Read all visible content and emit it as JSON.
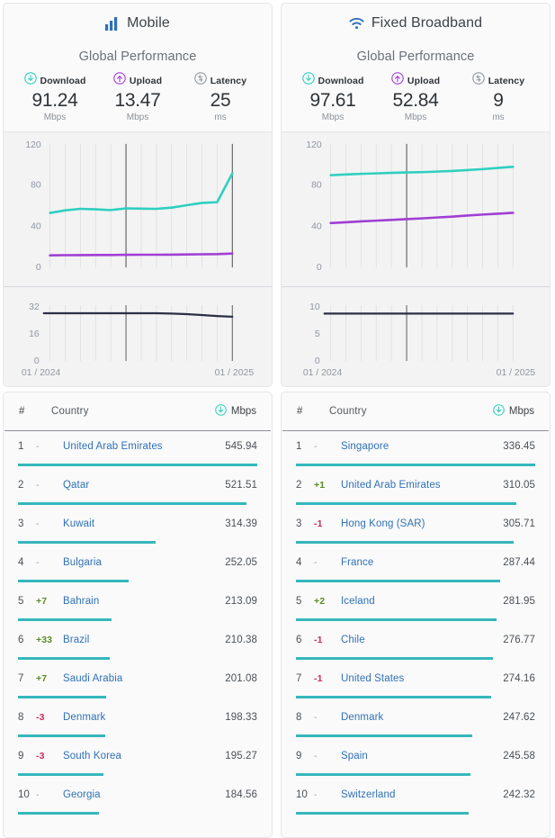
{
  "panels": [
    {
      "id": "mobile",
      "title": "Mobile",
      "icon": "bars-icon",
      "global_performance_label": "Global Performance",
      "metrics": [
        {
          "icon": "download-icon",
          "label": "Download",
          "value": "91.24",
          "unit": "Mbps"
        },
        {
          "icon": "upload-icon",
          "label": "Upload",
          "value": "13.47",
          "unit": "Mbps"
        },
        {
          "icon": "latency-icon",
          "label": "Latency",
          "value": "25",
          "unit": "ms"
        }
      ],
      "speed_chart": {
        "yticks": [
          "120",
          "80",
          "40",
          "0"
        ]
      },
      "latency_chart": {
        "yticks": [
          "32",
          "16",
          "0"
        ],
        "xticks": [
          "01 / 2024",
          "01 / 2025"
        ]
      },
      "table": {
        "headers": {
          "rank": "#",
          "country": "Country",
          "unit": "Mbps",
          "unit_icon": "download-icon"
        },
        "rows": [
          {
            "rank": "1",
            "delta": "-",
            "delta_dir": "flat",
            "country": "United Arab Emirates",
            "value": "545.94",
            "bar_pct": 100.0
          },
          {
            "rank": "2",
            "delta": "-",
            "delta_dir": "flat",
            "country": "Qatar",
            "value": "521.51",
            "bar_pct": 95.5
          },
          {
            "rank": "3",
            "delta": "-",
            "delta_dir": "flat",
            "country": "Kuwait",
            "value": "314.39",
            "bar_pct": 57.6
          },
          {
            "rank": "4",
            "delta": "-",
            "delta_dir": "flat",
            "country": "Bulgaria",
            "value": "252.05",
            "bar_pct": 46.2
          },
          {
            "rank": "5",
            "delta": "+7",
            "delta_dir": "up",
            "country": "Bahrain",
            "value": "213.09",
            "bar_pct": 39.0
          },
          {
            "rank": "6",
            "delta": "+33",
            "delta_dir": "up",
            "country": "Brazil",
            "value": "210.38",
            "bar_pct": 38.5
          },
          {
            "rank": "7",
            "delta": "+7",
            "delta_dir": "up",
            "country": "Saudi Arabia",
            "value": "201.08",
            "bar_pct": 36.8
          },
          {
            "rank": "8",
            "delta": "-3",
            "delta_dir": "down",
            "country": "Denmark",
            "value": "198.33",
            "bar_pct": 36.3
          },
          {
            "rank": "9",
            "delta": "-3",
            "delta_dir": "down",
            "country": "South Korea",
            "value": "195.27",
            "bar_pct": 35.8
          },
          {
            "rank": "10",
            "delta": "-",
            "delta_dir": "flat",
            "country": "Georgia",
            "value": "184.56",
            "bar_pct": 33.8
          }
        ]
      }
    },
    {
      "id": "fixed-broadband",
      "title": "Fixed Broadband",
      "icon": "wifi-icon",
      "global_performance_label": "Global Performance",
      "metrics": [
        {
          "icon": "download-icon",
          "label": "Download",
          "value": "97.61",
          "unit": "Mbps"
        },
        {
          "icon": "upload-icon",
          "label": "Upload",
          "value": "52.84",
          "unit": "Mbps"
        },
        {
          "icon": "latency-icon",
          "label": "Latency",
          "value": "9",
          "unit": "ms"
        }
      ],
      "speed_chart": {
        "yticks": [
          "120",
          "80",
          "40",
          "0"
        ]
      },
      "latency_chart": {
        "yticks": [
          "10",
          "5",
          "0"
        ],
        "xticks": [
          "01 / 2024",
          "01 / 2025"
        ]
      },
      "table": {
        "headers": {
          "rank": "#",
          "country": "Country",
          "unit": "Mbps",
          "unit_icon": "download-icon"
        },
        "rows": [
          {
            "rank": "1",
            "delta": "-",
            "delta_dir": "flat",
            "country": "Singapore",
            "value": "336.45",
            "bar_pct": 100.0
          },
          {
            "rank": "2",
            "delta": "+1",
            "delta_dir": "up",
            "country": "United Arab Emirates",
            "value": "310.05",
            "bar_pct": 92.2
          },
          {
            "rank": "3",
            "delta": "-1",
            "delta_dir": "down",
            "country": "Hong Kong (SAR)",
            "value": "305.71",
            "bar_pct": 90.9
          },
          {
            "rank": "4",
            "delta": "-",
            "delta_dir": "flat",
            "country": "France",
            "value": "287.44",
            "bar_pct": 85.4
          },
          {
            "rank": "5",
            "delta": "+2",
            "delta_dir": "up",
            "country": "Iceland",
            "value": "281.95",
            "bar_pct": 83.8
          },
          {
            "rank": "6",
            "delta": "-1",
            "delta_dir": "down",
            "country": "Chile",
            "value": "276.77",
            "bar_pct": 82.3
          },
          {
            "rank": "7",
            "delta": "-1",
            "delta_dir": "down",
            "country": "United States",
            "value": "274.16",
            "bar_pct": 81.5
          },
          {
            "rank": "8",
            "delta": "-",
            "delta_dir": "flat",
            "country": "Denmark",
            "value": "247.62",
            "bar_pct": 73.6
          },
          {
            "rank": "9",
            "delta": "-",
            "delta_dir": "flat",
            "country": "Spain",
            "value": "245.58",
            "bar_pct": 73.0
          },
          {
            "rank": "10",
            "delta": "-",
            "delta_dir": "flat",
            "country": "Switzerland",
            "value": "242.32",
            "bar_pct": 72.0
          }
        ]
      }
    }
  ],
  "colors": {
    "download_line": "#2ecfc0",
    "upload_line": "#a03ed4",
    "latency_line": "#2b2f45",
    "bar": "#35b7bc",
    "link": "#2f71b8",
    "up": "#5c8a24",
    "down": "#cf2b5b",
    "mode_icon": "#2f6fb5"
  },
  "chart_data": [
    {
      "type": "line",
      "title": "Mobile Global Performance",
      "panel": "mobile",
      "xlabel": "",
      "ylabel": "Mbps",
      "ylim": [
        0,
        120
      ],
      "yticks": [
        0,
        40,
        80,
        120
      ],
      "x": [
        "01/2024",
        "02/2024",
        "03/2024",
        "04/2024",
        "05/2024",
        "06/2024",
        "07/2024",
        "08/2024",
        "09/2024",
        "10/2024",
        "11/2024",
        "12/2024",
        "01/2025"
      ],
      "grid": true,
      "legend": "none",
      "series": [
        {
          "name": "Download",
          "color": "#2ecfc0",
          "values": [
            53.0,
            55.5,
            57.0,
            56.5,
            55.8,
            57.4,
            57.2,
            57.0,
            58.2,
            60.5,
            62.8,
            63.5,
            91.24
          ]
        },
        {
          "name": "Upload",
          "color": "#a03ed4",
          "values": [
            11.6,
            11.8,
            11.9,
            12.0,
            12.0,
            12.1,
            12.2,
            12.2,
            12.3,
            12.5,
            12.7,
            12.9,
            13.47
          ]
        }
      ]
    },
    {
      "type": "line",
      "title": "Mobile Latency",
      "panel": "mobile",
      "xlabel": "",
      "ylabel": "ms",
      "ylim": [
        0,
        32
      ],
      "yticks": [
        0,
        16,
        32
      ],
      "xticklabels": [
        "01 / 2024",
        "01 / 2025"
      ],
      "x": [
        "01/2024",
        "02/2024",
        "03/2024",
        "04/2024",
        "05/2024",
        "06/2024",
        "07/2024",
        "08/2024",
        "09/2024",
        "10/2024",
        "11/2024",
        "12/2024",
        "01/2025"
      ],
      "grid": true,
      "legend": "none",
      "series": [
        {
          "name": "Latency",
          "color": "#2b2f45",
          "values": [
            27.0,
            27.0,
            27.0,
            27.0,
            27.0,
            27.0,
            27.0,
            27.0,
            26.8,
            26.5,
            26.0,
            25.4,
            25.0
          ]
        }
      ]
    },
    {
      "type": "line",
      "title": "Fixed Broadband Global Performance",
      "panel": "fixed-broadband",
      "xlabel": "",
      "ylabel": "Mbps",
      "ylim": [
        0,
        120
      ],
      "yticks": [
        0,
        40,
        80,
        120
      ],
      "x": [
        "01/2024",
        "02/2024",
        "03/2024",
        "04/2024",
        "05/2024",
        "06/2024",
        "07/2024",
        "08/2024",
        "09/2024",
        "10/2024",
        "11/2024",
        "12/2024",
        "01/2025"
      ],
      "grid": true,
      "legend": "none",
      "series": [
        {
          "name": "Download",
          "color": "#2ecfc0",
          "values": [
            89.5,
            90.2,
            90.8,
            91.3,
            91.8,
            92.2,
            92.5,
            93.0,
            93.6,
            94.5,
            95.4,
            96.5,
            97.61
          ]
        },
        {
          "name": "Upload",
          "color": "#a03ed4",
          "values": [
            43.0,
            43.8,
            44.6,
            45.3,
            46.0,
            46.8,
            47.5,
            48.3,
            49.2,
            50.2,
            51.2,
            52.0,
            52.84
          ]
        }
      ]
    },
    {
      "type": "line",
      "title": "Fixed Broadband Latency",
      "panel": "fixed-broadband",
      "xlabel": "",
      "ylabel": "ms",
      "ylim": [
        0,
        10
      ],
      "yticks": [
        0,
        5,
        10
      ],
      "xticklabels": [
        "01 / 2024",
        "01 / 2025"
      ],
      "x": [
        "01/2024",
        "02/2024",
        "03/2024",
        "04/2024",
        "05/2024",
        "06/2024",
        "07/2024",
        "08/2024",
        "09/2024",
        "10/2024",
        "11/2024",
        "12/2024",
        "01/2025"
      ],
      "grid": true,
      "legend": "none",
      "series": [
        {
          "name": "Latency",
          "color": "#2b2f45",
          "values": [
            9.0,
            9.0,
            9.0,
            9.0,
            9.0,
            9.0,
            9.0,
            9.0,
            9.0,
            9.0,
            9.0,
            9.0,
            9.0
          ]
        }
      ]
    }
  ]
}
